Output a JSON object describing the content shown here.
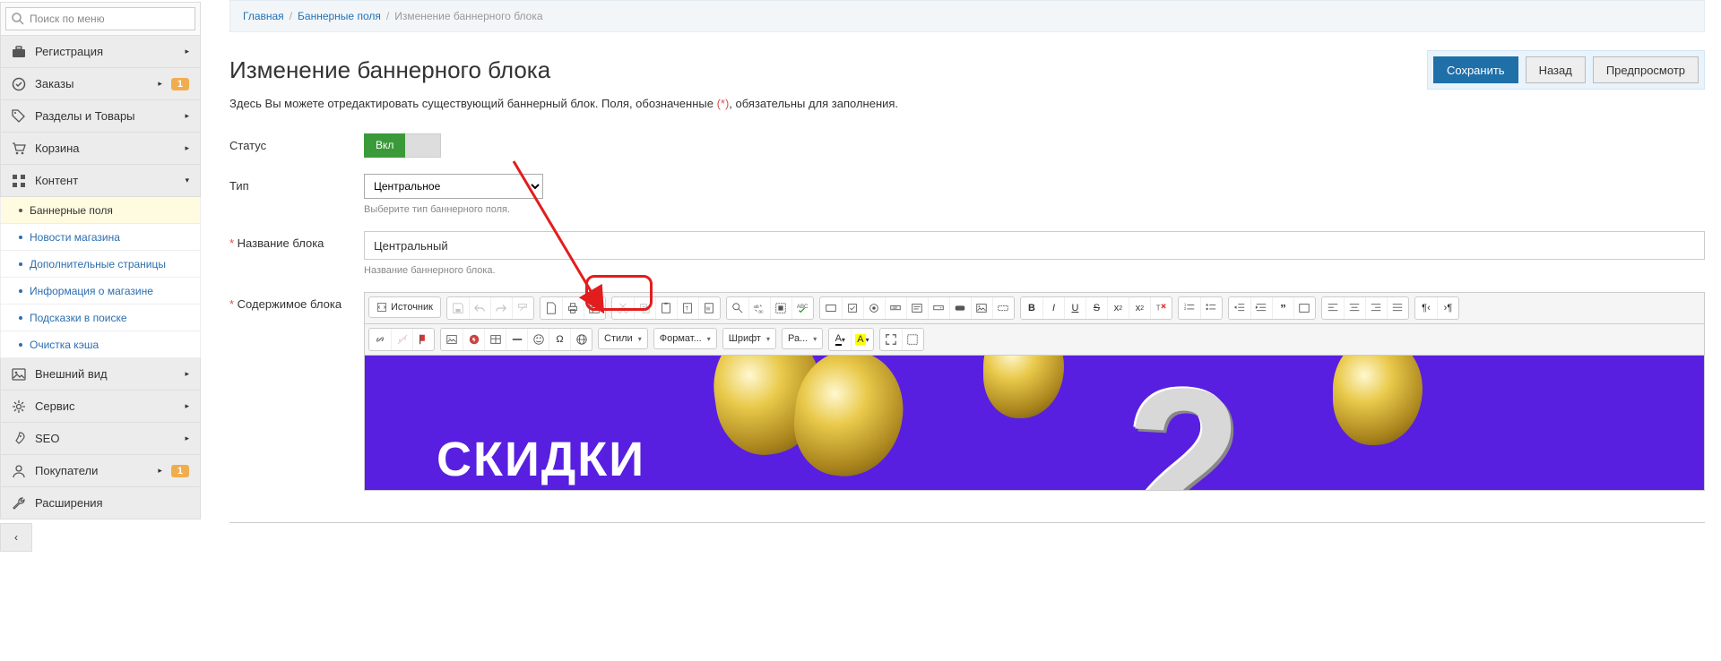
{
  "sidebar": {
    "search_placeholder": "Поиск по меню",
    "items": [
      {
        "icon": "briefcase",
        "label": "Регистрация",
        "caret": "right"
      },
      {
        "icon": "check-circle",
        "label": "Заказы",
        "caret": "right",
        "badge": "1"
      },
      {
        "icon": "tags",
        "label": "Разделы и Товары",
        "caret": "right"
      },
      {
        "icon": "cart",
        "label": "Корзина",
        "caret": "right"
      },
      {
        "icon": "grid",
        "label": "Контент",
        "caret": "down",
        "sub": [
          {
            "label": "Баннерные поля",
            "active": true
          },
          {
            "label": "Новости магазина"
          },
          {
            "label": "Дополнительные страницы"
          },
          {
            "label": "Информация о магазине"
          },
          {
            "label": "Подсказки в поиске"
          },
          {
            "label": "Очистка кэша"
          }
        ]
      },
      {
        "icon": "image",
        "label": "Внешний вид",
        "caret": "right"
      },
      {
        "icon": "gear",
        "label": "Сервис",
        "caret": "right"
      },
      {
        "icon": "rocket",
        "label": "SEO",
        "caret": "right"
      },
      {
        "icon": "user",
        "label": "Покупатели",
        "caret": "right",
        "badge": "1"
      },
      {
        "icon": "wrench",
        "label": "Расширения"
      }
    ]
  },
  "breadcrumbs": {
    "home": "Главная",
    "mid": "Баннерные поля",
    "current": "Изменение баннерного блока"
  },
  "page": {
    "title": "Изменение баннерного блока",
    "subtitle_prefix": "Здесь Вы можете отредактировать существующий баннерный блок. Поля, обозначенные ",
    "subtitle_marker": "(*)",
    "subtitle_suffix": ", обязательны для заполнения."
  },
  "actions": {
    "save": "Сохранить",
    "back": "Назад",
    "preview": "Предпросмотр"
  },
  "form": {
    "status_label": "Статус",
    "status_value": "Вкл",
    "type_label": "Тип",
    "type_value": "Центральное",
    "type_hint": "Выберите тип баннерного поля.",
    "name_label": "Название блока",
    "name_value": "Центральный",
    "name_hint": "Название баннерного блока.",
    "content_label": "Содержимое блока"
  },
  "editor": {
    "source": "Источник",
    "combos": {
      "styles": "Стили",
      "format": "Формат...",
      "font": "Шрифт",
      "size": "Ра..."
    }
  },
  "banner": {
    "headline": "СКИДКИ"
  }
}
